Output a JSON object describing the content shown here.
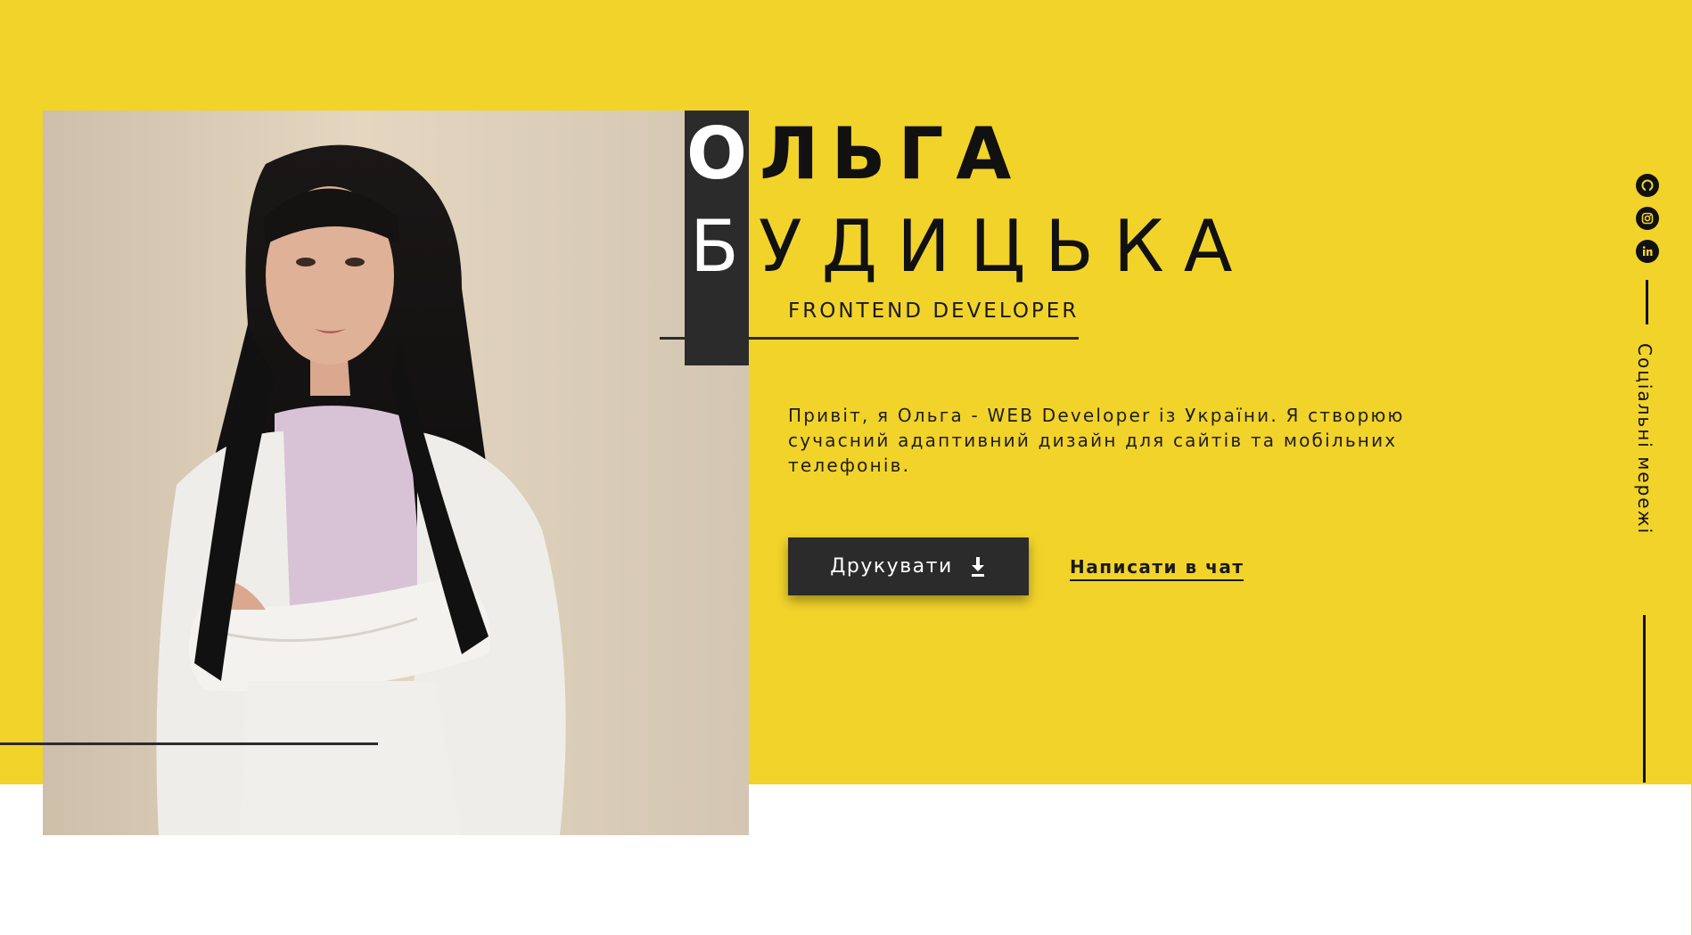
{
  "hero": {
    "first_name_initial": "О",
    "first_name_rest": "ЛЬГА",
    "last_name_initial": "Б",
    "last_name_rest": "УДИЦЬКА",
    "role": "FRONTEND DEVELOPER",
    "intro": "Привіт, я Ольга - WEB Developer із України. Я створюю сучасний адаптивний дизайн для сайтів та мобільних телефонів.",
    "print_button_label": "Друкувати",
    "chat_link_label": "Написати в чат"
  },
  "social": {
    "label": "Соціальні мережі",
    "icons": [
      "github-icon",
      "instagram-icon",
      "linkedin-icon"
    ]
  },
  "colors": {
    "accent": "#f2d32a",
    "dark": "#2b2b2b",
    "text": "#111111",
    "background": "#ffffff"
  }
}
